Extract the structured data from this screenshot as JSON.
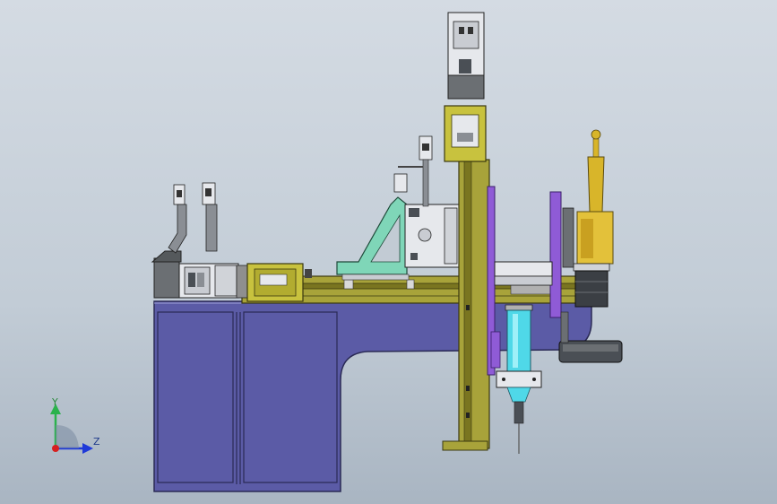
{
  "viewport": {
    "background_top": "#d4dbe3",
    "background_bottom": "#a9b5c2"
  },
  "colors": {
    "base_fill": "#5a5aa0",
    "base_stroke": "#2a2a55",
    "rail_fill": "#a8a33a",
    "rail_dark": "#7a7520",
    "bracket_green": "#7fd6b8",
    "accent_purple": "#8f5bd6",
    "syringe_cyan": "#4fd8e8",
    "camera_yellow": "#d8b52a",
    "motor_grey": "#6b6f73",
    "part_light": "#e6e8ec"
  },
  "triad": {
    "y_label": "Y",
    "z_label": "Z",
    "y_color": "#2bb24c",
    "z_color": "#1f3ad8",
    "origin_color": "#d62020"
  },
  "icons": {
    "triad": "axis-triad-icon"
  }
}
